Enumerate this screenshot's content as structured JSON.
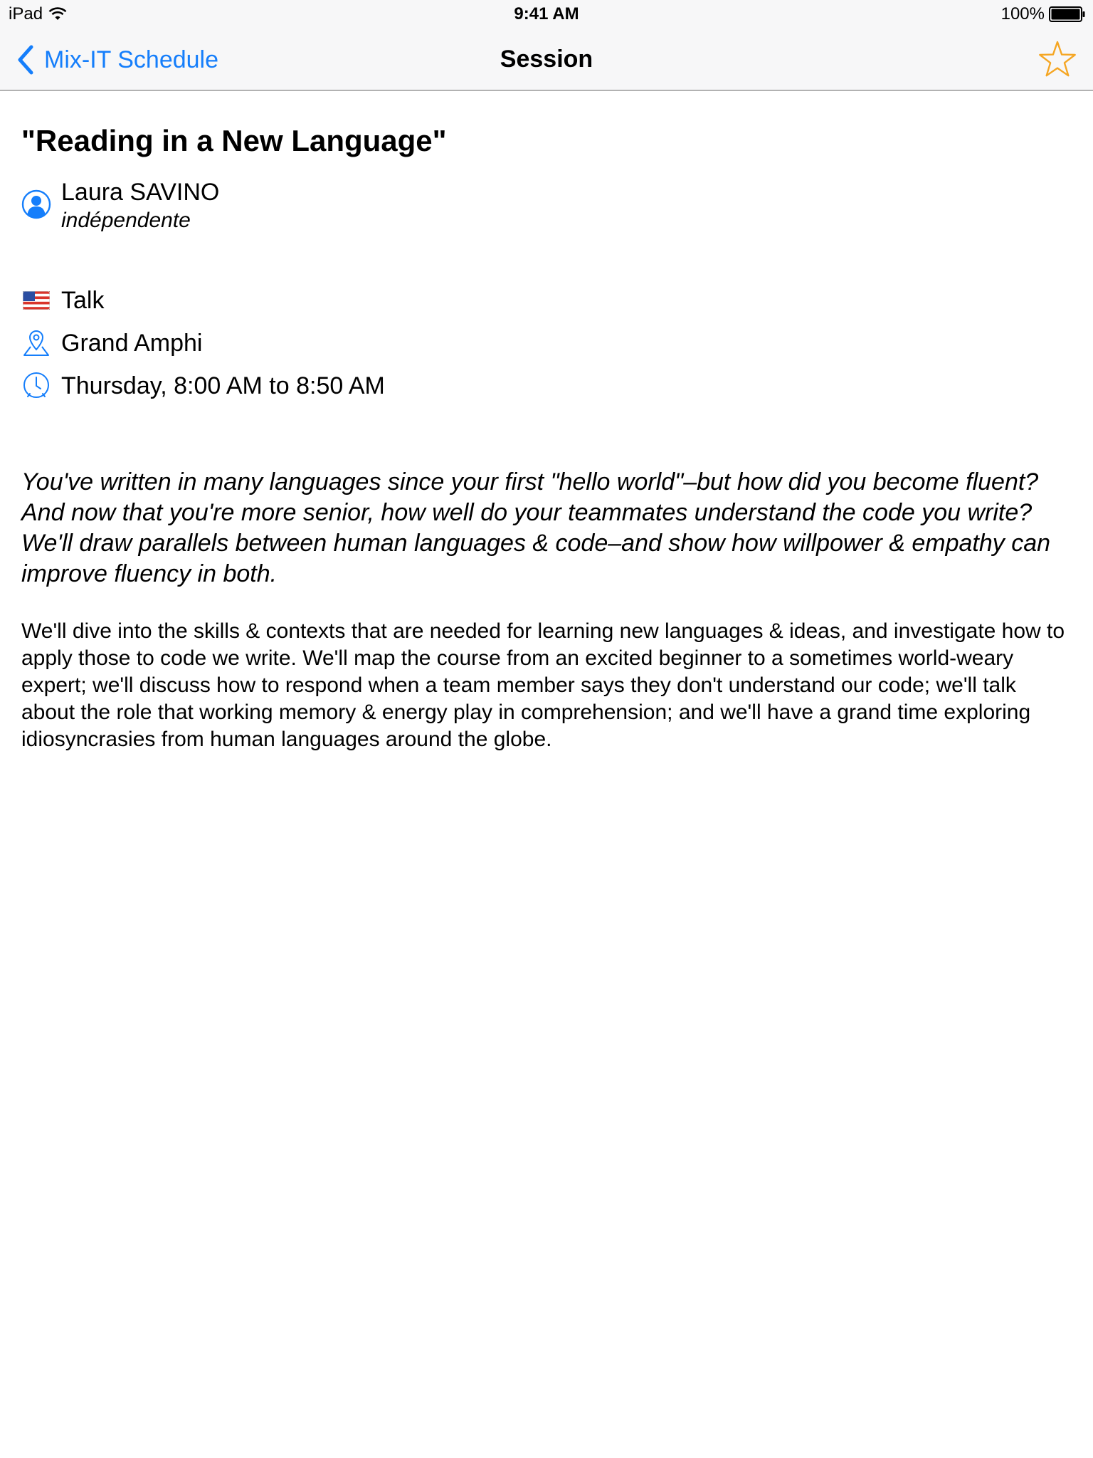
{
  "status_bar": {
    "device": "iPad",
    "time": "9:41 AM",
    "battery": "100%",
    "icons": [
      "wifi-icon",
      "battery-icon"
    ]
  },
  "nav": {
    "back_label": "Mix-IT Schedule",
    "title": "Session",
    "favorite_icon": "star-icon"
  },
  "session": {
    "title": "\"Reading in a New Language\"",
    "speaker": {
      "name": "Laura SAVINO",
      "company": "indépendente"
    },
    "format": "Talk",
    "language_flag": "us-flag-icon",
    "room": "Grand Amphi",
    "time": "Thursday, 8:00 AM to 8:50 AM",
    "summary": "You've written in many languages since your first \"hello world\"–but how did you become fluent? And now that you're more senior, how well do your teammates understand the code you write? We'll draw parallels between human languages & code–and show how willpower & empathy can improve fluency in both.",
    "description": "We'll dive into the skills & contexts that are needed for learning new languages & ideas, and investigate how to apply those to code we write. We'll map the course from an excited beginner to a sometimes world-weary expert; we'll discuss how to respond when a team member says they don't understand our code; we'll talk about the role that working memory & energy play in comprehension; and we'll have a grand time exploring idiosyncrasies from human languages around the globe."
  },
  "colors": {
    "accent": "#157efb",
    "favorite": "#f5a623",
    "bar_background": "#f7f7f8"
  }
}
